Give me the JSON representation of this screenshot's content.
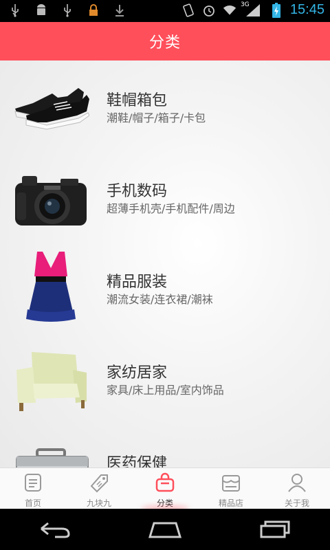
{
  "status": {
    "time": "15:45",
    "network": "3G"
  },
  "header": {
    "title": "分类"
  },
  "categories": [
    {
      "title": "鞋帽箱包",
      "sub": "潮鞋/帽子/箱子/卡包",
      "icon": "sneaker-icon"
    },
    {
      "title": "手机数码",
      "sub": "超薄手机壳/手机配件/周边",
      "icon": "camera-icon"
    },
    {
      "title": "精品服装",
      "sub": "潮流女装/连衣裙/潮袜",
      "icon": "dress-icon"
    },
    {
      "title": "家纺居家",
      "sub": "家具/床上用品/室内饰品",
      "icon": "armchair-icon"
    },
    {
      "title": "医药保健",
      "sub": "",
      "icon": "medical-case-icon"
    }
  ],
  "tabs": [
    {
      "label": "首页",
      "icon": "home-doc-icon",
      "active": false
    },
    {
      "label": "九块九",
      "icon": "tag-icon",
      "active": false
    },
    {
      "label": "分类",
      "icon": "bag-icon",
      "active": true
    },
    {
      "label": "精品店",
      "icon": "store-icon",
      "active": false
    },
    {
      "label": "关于我",
      "icon": "user-icon",
      "active": false
    }
  ],
  "colors": {
    "accent": "#ff4f5b",
    "time": "#33b5e5"
  }
}
